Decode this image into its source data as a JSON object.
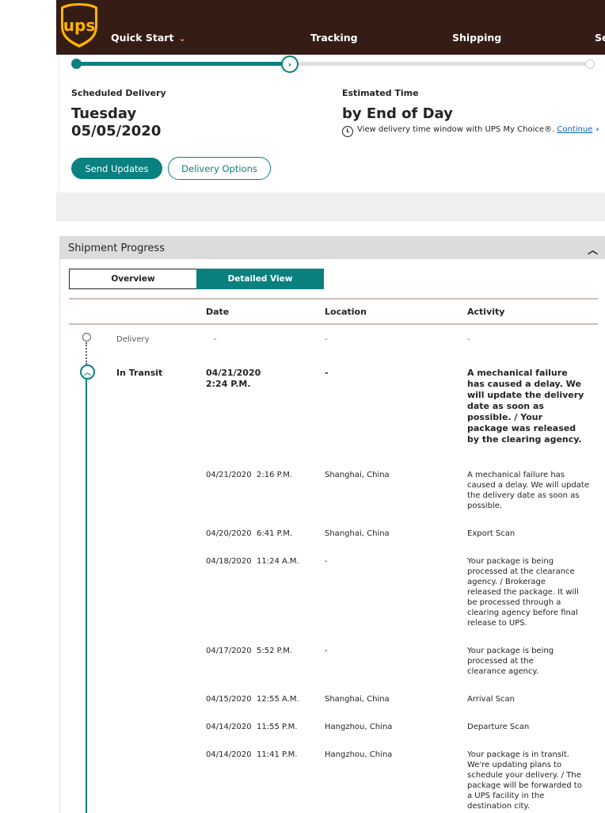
{
  "header": {
    "logo_text": "ups",
    "nav": {
      "quick_start": "Quick Start",
      "tracking": "Tracking",
      "shipping": "Shipping",
      "next_partial": "Se"
    },
    "brand_color": "#351c15",
    "accent_gold": "#ffb500"
  },
  "progress": {
    "fraction_complete": 0.42,
    "accent_color": "#0a8080"
  },
  "delivery": {
    "scheduled_label": "Scheduled Delivery",
    "scheduled_day": "Tuesday",
    "scheduled_date": "05/05/2020",
    "estimated_label": "Estimated Time",
    "estimated_value": "by End of Day",
    "mychoice_text": "View delivery time window with UPS My Choice®.",
    "mychoice_link": "Continue",
    "send_updates": "Send Updates",
    "delivery_options": "Delivery Options"
  },
  "shipment_progress": {
    "title": "Shipment Progress",
    "tabs": {
      "overview": "Overview",
      "detailed": "Detailed View",
      "active": "detailed"
    },
    "columns": {
      "date": "Date",
      "location": "Location",
      "activity": "Activity"
    },
    "rows": [
      {
        "status": "Delivery",
        "date": "-",
        "location": "-",
        "activity": "-"
      },
      {
        "status": "In Transit",
        "date_line1": "04/21/2020",
        "date_line2": "2:24 P.M.",
        "location": "-",
        "activity": "A mechanical failure has caused a delay. We will update the delivery date as soon as possible. / Your package was released by the clearing agency."
      },
      {
        "date": "04/21/2020  2:16 P.M.",
        "location": "Shanghai, China",
        "activity": "A mechanical failure has caused a delay. We will update the delivery date as soon as possible."
      },
      {
        "date": "04/20/2020  6:41 P.M.",
        "location": "Shanghai, China",
        "activity": "Export Scan"
      },
      {
        "date": "04/18/2020  11:24 A.M.",
        "location": "-",
        "activity": "Your package is being processed at the clearance agency. / Brokerage released the package. It will be processed through a clearing agency before final release to UPS."
      },
      {
        "date": "04/17/2020  5:52 P.M.",
        "location": "-",
        "activity": "Your package is being processed at the clearance agency."
      },
      {
        "date": "04/15/2020  12:55 A.M.",
        "location": "Shanghai, China",
        "activity": "Arrival Scan"
      },
      {
        "date": "04/14/2020  11:55 P.M.",
        "location": "Hangzhou, China",
        "activity": "Departure Scan"
      },
      {
        "date": "04/14/2020  11:41 P.M.",
        "location": "Hangzhou, China",
        "activity": "Your package is in transit. We're updating plans to schedule your delivery. / The package will be forwarded to a UPS facility in the destination city."
      }
    ]
  }
}
